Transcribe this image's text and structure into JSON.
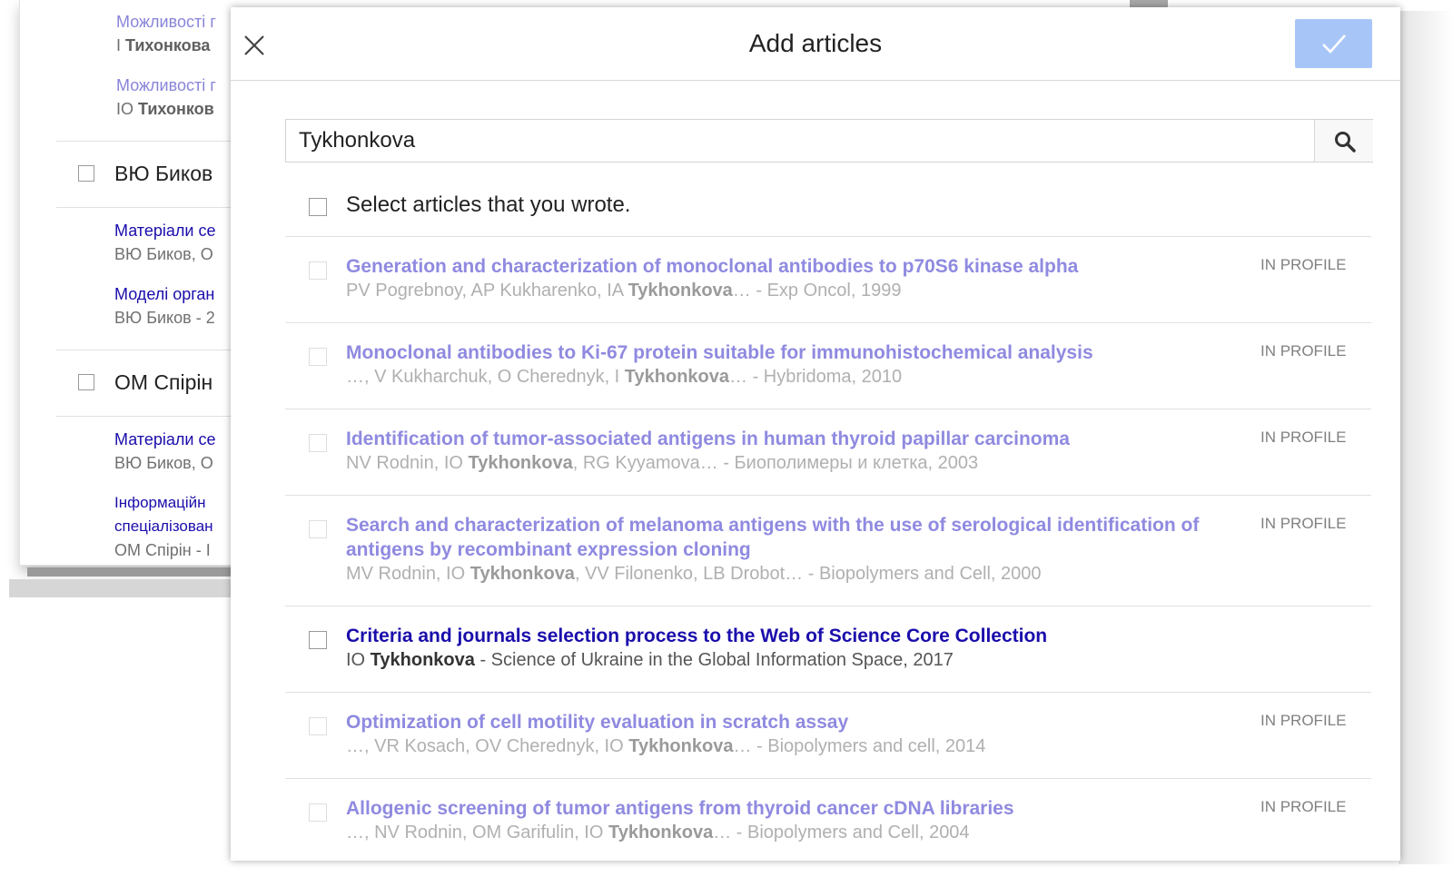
{
  "background": {
    "links": [
      {
        "title": "Можливості г",
        "authors_pre": "І ",
        "authors_bold": "Тихонкова",
        "style": "faint"
      },
      {
        "title": "Можливості г",
        "authors_pre": "ІО ",
        "authors_bold": "Тихонков",
        "style": "faint"
      }
    ],
    "authors": [
      {
        "name": "ВЮ Биков"
      },
      {
        "name": "ОМ Спірін"
      }
    ],
    "bykov_links": [
      {
        "title": "Матеріали се",
        "sub": "ВЮ Биков, О"
      },
      {
        "title": "Моделі орган",
        "sub": "ВЮ Биков - 2"
      }
    ],
    "spirin_links": [
      {
        "title": "Матеріали се",
        "sub": "ВЮ Биков, О"
      },
      {
        "title_line1": "Інформаційн",
        "title_line2": "спеціалізован",
        "sub": "ОМ Спірін - І"
      }
    ]
  },
  "dialog": {
    "title": "Add articles",
    "close_icon": "close-icon",
    "done_icon": "checkmark-icon",
    "done_color": "#a7c6f7",
    "search": {
      "value": "Tykhonkova",
      "search_icon": "search-icon"
    },
    "select_all_label": "Select articles that you wrote.",
    "in_profile_label": "IN PROFILE",
    "articles": [
      {
        "title": "Generation and characterization of monoclonal antibodies to p70S6 kinase alpha",
        "authors_pre": "PV Pogrebnoy, AP Kukharenko, IA ",
        "authors_bold": "Tykhonkova",
        "authors_post": "… - Exp Oncol, 1999",
        "in_profile": true
      },
      {
        "title": "Monoclonal antibodies to Ki-67 protein suitable for immunohistochemical analysis",
        "authors_pre": "…, V Kukharchuk, O Cherednyk, I ",
        "authors_bold": "Tykhonkova",
        "authors_post": "… - Hybridoma, 2010",
        "in_profile": true
      },
      {
        "title": "Identification of tumor-associated antigens in human thyroid papillar carcinoma",
        "authors_pre": "NV Rodnin, IO ",
        "authors_bold": "Tykhonkova",
        "authors_post": ", RG Kyyamova… - Биополимеры и клетка, 2003",
        "in_profile": true
      },
      {
        "title": "Search and characterization of melanoma antigens with the use of serological identification of antigens by recombinant expression cloning",
        "authors_pre": "MV Rodnin, IO ",
        "authors_bold": "Tykhonkova",
        "authors_post": ", VV Filonenko, LB Drobot… - Biopolymers and Cell, 2000",
        "in_profile": true
      },
      {
        "title": "Criteria and journals selection process to the Web of Science Core Collection",
        "authors_pre": "IO ",
        "authors_bold": "Tykhonkova",
        "authors_post": " - Science of Ukraine in the Global Information Space, 2017",
        "in_profile": false
      },
      {
        "title": "Optimization of cell motility evaluation in scratch assay",
        "authors_pre": "…, VR Kosach, OV Cherednyk, IO ",
        "authors_bold": "Tykhonkova",
        "authors_post": "… - Biopolymers and cell, 2014",
        "in_profile": true
      },
      {
        "title": "Allogenic screening of tumor antigens from thyroid cancer cDNA libraries",
        "authors_pre": "…, NV Rodnin, OM Garifulin, IO ",
        "authors_bold": "Tykhonkova",
        "authors_post": "… - Biopolymers and Cell, 2004",
        "in_profile": true
      }
    ]
  }
}
